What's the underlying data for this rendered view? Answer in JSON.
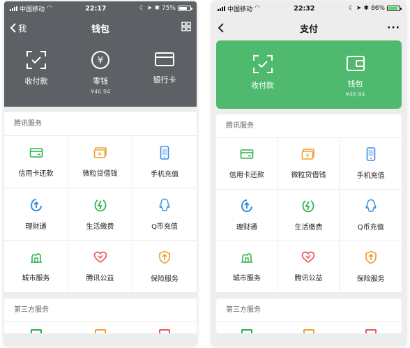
{
  "left": {
    "status": {
      "carrier": "中国移动",
      "time": "22:17",
      "battery": "75%",
      "battery_level": 0.75,
      "battery_color": "#ffffff"
    },
    "nav": {
      "back_label": "我",
      "title": "钱包"
    },
    "hero": [
      {
        "label": "收付款",
        "sub": ""
      },
      {
        "label": "零钱",
        "sub": "¥46.94"
      },
      {
        "label": "银行卡",
        "sub": ""
      }
    ],
    "tencent": {
      "title": "腾讯服务",
      "items": [
        {
          "label": "信用卡还款",
          "icon": "credit-card-icon"
        },
        {
          "label": "微粒贷借钱",
          "icon": "loan-icon"
        },
        {
          "label": "手机充值",
          "icon": "phone-icon"
        },
        {
          "label": "理财通",
          "icon": "wealth-icon"
        },
        {
          "label": "生活缴费",
          "icon": "utility-icon"
        },
        {
          "label": "Q币充值",
          "icon": "qq-icon"
        },
        {
          "label": "城市服务",
          "icon": "city-icon"
        },
        {
          "label": "腾讯公益",
          "icon": "charity-icon"
        },
        {
          "label": "保险服务",
          "icon": "insurance-icon"
        }
      ]
    },
    "third": {
      "title": "第三方服务"
    }
  },
  "right": {
    "status": {
      "carrier": "中国移动",
      "time": "22:32",
      "battery": "86%",
      "battery_level": 0.86,
      "battery_color": "#4cd964"
    },
    "nav": {
      "title": "支付",
      "more_label": "···"
    },
    "hero": [
      {
        "label": "收付款",
        "sub": ""
      },
      {
        "label": "钱包",
        "sub": "¥46.94"
      }
    ],
    "tencent": {
      "title": "腾讯服务",
      "items": [
        {
          "label": "信用卡还款",
          "icon": "credit-card-icon"
        },
        {
          "label": "微粒贷借钱",
          "icon": "loan-icon"
        },
        {
          "label": "手机充值",
          "icon": "phone-icon"
        },
        {
          "label": "理财通",
          "icon": "wealth-icon"
        },
        {
          "label": "生活缴费",
          "icon": "utility-icon"
        },
        {
          "label": "Q币充值",
          "icon": "qq-icon"
        },
        {
          "label": "城市服务",
          "icon": "city-icon"
        },
        {
          "label": "腾讯公益",
          "icon": "charity-icon"
        },
        {
          "label": "保险服务",
          "icon": "insurance-icon"
        }
      ]
    },
    "third": {
      "title": "第三方服务"
    }
  },
  "colors": {
    "left_header": "#5d6166",
    "right_hero": "#4fba6e",
    "green": "#2bb24c",
    "orange": "#f0a030",
    "blue": "#3a8fe0",
    "red": "#e85a5a"
  }
}
